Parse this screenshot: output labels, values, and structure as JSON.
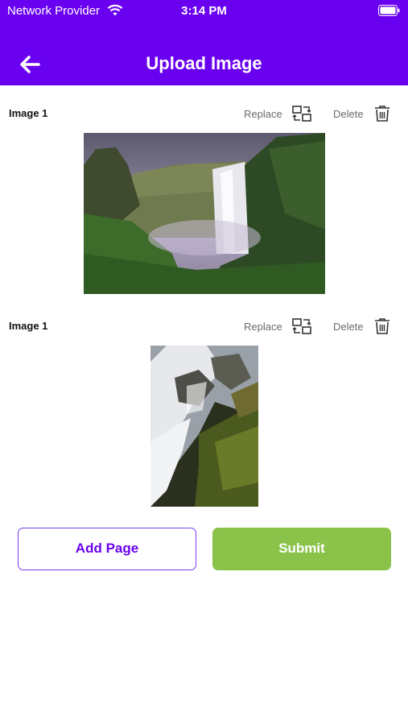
{
  "status_bar": {
    "carrier": "Network Provider",
    "time": "3:14 PM"
  },
  "header": {
    "title": "Upload Image"
  },
  "images": [
    {
      "label": "Image 1",
      "replace_label": "Replace",
      "delete_label": "Delete"
    },
    {
      "label": "Image 1",
      "replace_label": "Replace",
      "delete_label": "Delete"
    }
  ],
  "buttons": {
    "add_page": "Add Page",
    "submit": "Submit"
  },
  "colors": {
    "primary": "#6a00f0",
    "submit": "#8bc34a",
    "action_text": "#6b6b6b"
  }
}
